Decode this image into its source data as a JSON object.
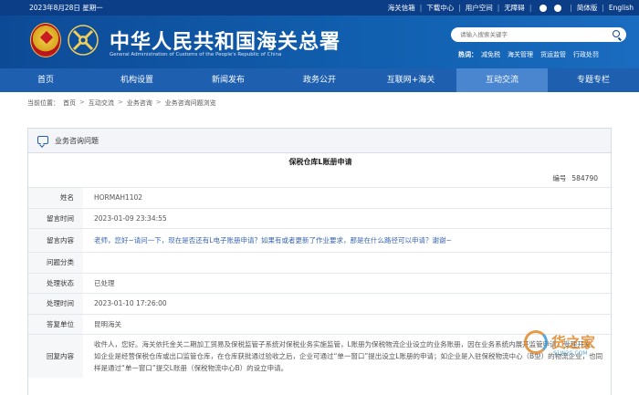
{
  "topbar": {
    "date": "2023年8月28日 星期一",
    "links": [
      "海关信箱",
      "下载中心",
      "用户空间",
      "无障碍"
    ],
    "simplified": "简体版",
    "english": "English"
  },
  "header": {
    "title": "中华人民共和国海关总署",
    "subtitle": "General Administration of Customs of the People's Republic of China",
    "search_placeholder": "请输入搜索关键字",
    "hot_label": "热词：",
    "hot_words": [
      "减免税",
      "海关管理",
      "货运监管",
      "行政处罚"
    ]
  },
  "nav": {
    "items": [
      "首页",
      "机构设置",
      "新闻发布",
      "政务公开",
      "互联网+海关",
      "互动交流",
      "专题专栏"
    ],
    "active_index": 5
  },
  "breadcrumb": {
    "prefix": "当前位置：",
    "items": [
      "首页",
      "互动交流",
      "业务咨询",
      "业务咨询问题浏览"
    ]
  },
  "panel": {
    "heading": "业务咨询问题",
    "question_title": "保税仓库L账册申请",
    "number_label": "编号",
    "number_value": "584790",
    "rows": {
      "name_label": "姓名",
      "name_value": "HORMAH1102",
      "msg_time_label": "留言时间",
      "msg_time_value": "2023-01-09 23:34:55",
      "msg_content_label": "留言内容",
      "msg_content_value": "老师，您好~请问一下，现在是否还有L电子账册申请？如果有或者更新了作业要求，那是在什么路径可以申请？谢谢~",
      "category_label": "问题分类",
      "category_value": "",
      "status_label": "处理状态",
      "status_value": "已处理",
      "process_time_label": "处理时间",
      "process_time_value": "2023-01-10 17:26:00",
      "unit_label": "答复单位",
      "unit_value": "昆明海关",
      "reply_label": "回复内容",
      "reply_value": "收件人，您好。海关依托金关二期加工贸易及保税监管子系统对保税业务实施监管，L账册为保税物流企业设立的业务账册，因在业务系统内展开监管申请、受理开发。如企业是经营保税仓库或出口监管仓库，在仓库获批通过验收之后，企业可通过“单一窗口”提出设立L账册的申请；如企业是入驻保税物流中心（B型）的物流企业，也同样是通过“单一窗口”提交L账册（保税物流中心B）的设立申请。"
    }
  },
  "watermark": {
    "text": "货之家",
    "url": "S1W2C.COM"
  }
}
